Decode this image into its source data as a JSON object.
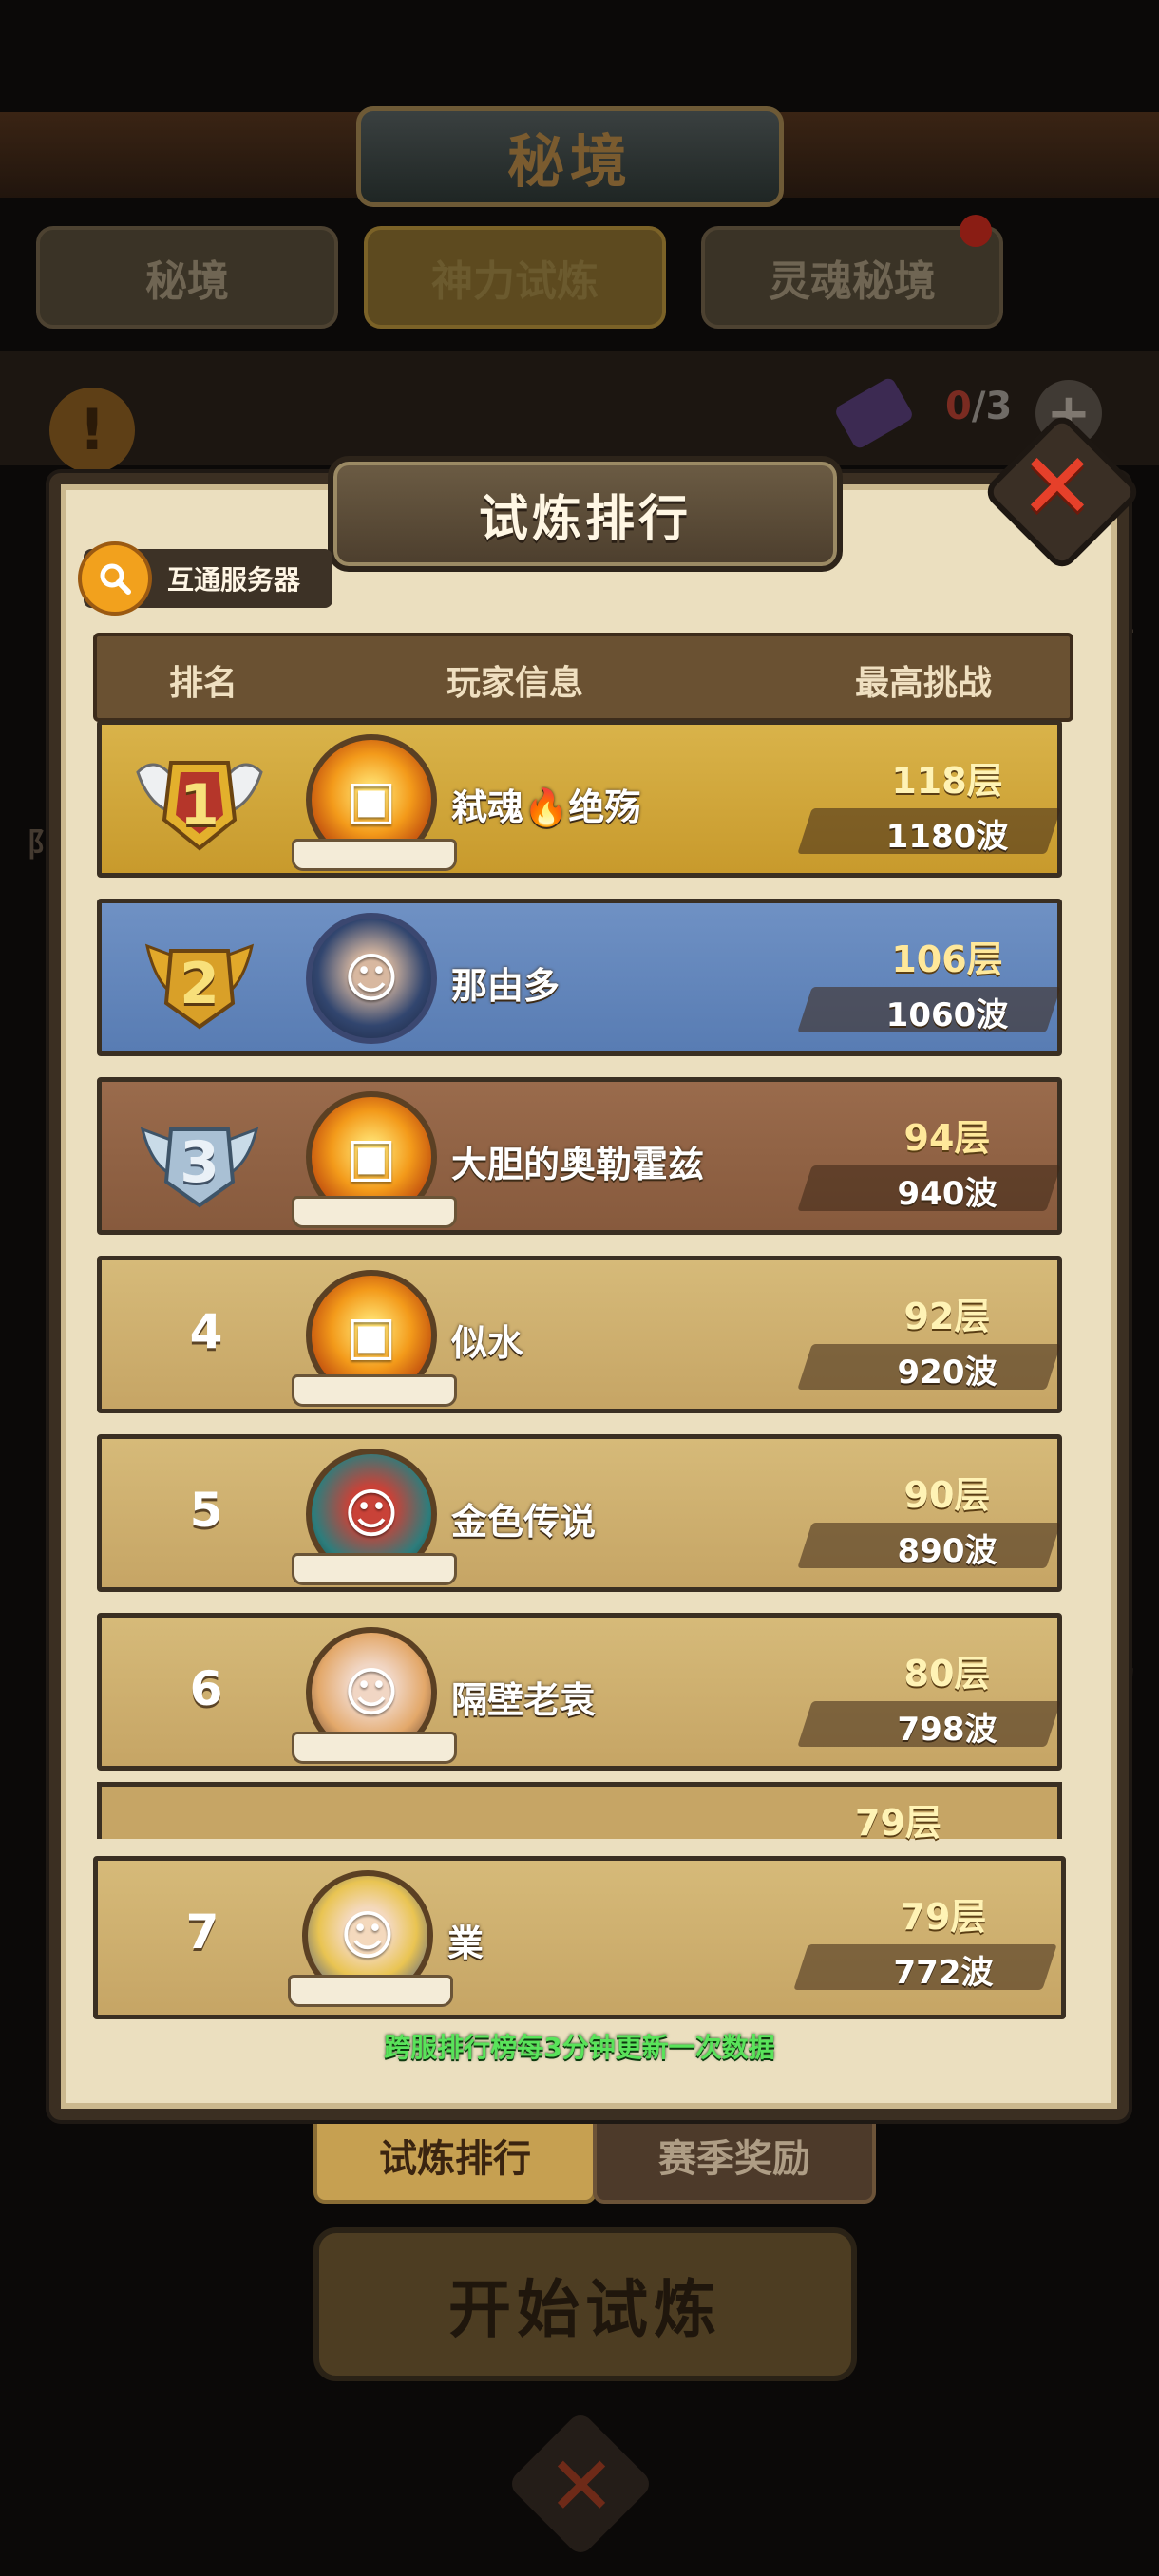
{
  "background": {
    "title": "秘境",
    "tabs": [
      "秘境",
      "神力试炼",
      "灵魂秘境"
    ],
    "ticket_count_current": "0",
    "ticket_count_total": "/3",
    "bottom_tabs": [
      "试炼排行",
      "赛季奖励"
    ],
    "start_button": "开始试炼"
  },
  "panel": {
    "title": "试炼排行",
    "server_button": "互通服务器",
    "headers": {
      "rank": "排名",
      "player": "玩家信息",
      "best": "最高挑战"
    },
    "rows": [
      {
        "rank": "1",
        "name": "弒魂🔥绝殇",
        "floor": "118层",
        "wave": "1180波",
        "style": "gold",
        "avatar": "fire"
      },
      {
        "rank": "2",
        "name": "那由多",
        "floor": "106层",
        "wave": "1060波",
        "style": "blue",
        "avatar": "blue-hero"
      },
      {
        "rank": "3",
        "name": "大胆的奥勒霍兹",
        "floor": "94层",
        "wave": "940波",
        "style": "bronze",
        "avatar": "fire"
      },
      {
        "rank": "4",
        "name": "似水",
        "floor": "92层",
        "wave": "920波",
        "style": "plain",
        "avatar": "fire"
      },
      {
        "rank": "5",
        "name": "金色传说",
        "floor": "90层",
        "wave": "890波",
        "style": "plain",
        "avatar": "red-hero"
      },
      {
        "rank": "6",
        "name": "隔壁老袁",
        "floor": "80层",
        "wave": "798波",
        "style": "plain",
        "avatar": "pale-hero"
      }
    ],
    "partial_row_floor": "79层",
    "my_row": {
      "rank": "7",
      "name": "業",
      "floor": "79层",
      "wave": "772波"
    },
    "footer_note": "跨服排行榜每3分钟更新一次数据"
  },
  "colors": {
    "gold_row": "#d9b34a",
    "blue_row": "#6f91c4",
    "bronze_row": "#9a6b4c",
    "plain_row": "#d6ba79",
    "footer_green": "#59e35a",
    "close_red": "#e6402a"
  }
}
